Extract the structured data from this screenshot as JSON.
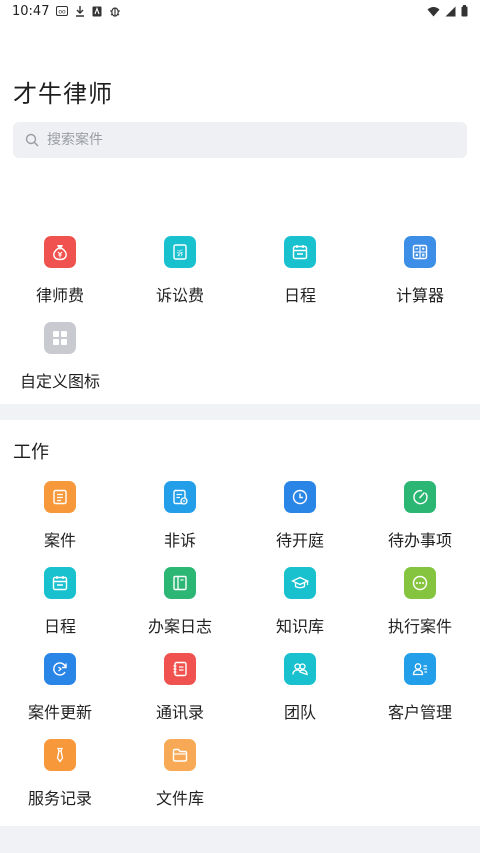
{
  "status_bar": {
    "time": "10:47",
    "left_icons": [
      "cast-icon",
      "download-icon",
      "font-icon",
      "bug-icon"
    ],
    "right_icons": [
      "wifi-icon",
      "signal-icon",
      "battery-icon"
    ]
  },
  "header": {
    "title": "才牛律师"
  },
  "search": {
    "placeholder": "搜索案件"
  },
  "quick_tools": [
    {
      "label": "律师费",
      "icon": "fee-bag-icon",
      "color": "#f0534f"
    },
    {
      "label": "诉讼费",
      "icon": "lawsuit-doc-icon",
      "color": "#19c1cf"
    },
    {
      "label": "日程",
      "icon": "calendar-icon",
      "color": "#19c1cf"
    },
    {
      "label": "计算器",
      "icon": "calculator-icon",
      "color": "#3d8ee6"
    },
    {
      "label": "自定义图标",
      "icon": "grid-icon",
      "color": "#c8cacf"
    }
  ],
  "work": {
    "title": "工作",
    "items": [
      {
        "label": "案件",
        "icon": "case-doc-icon",
        "color": "#f7983a"
      },
      {
        "label": "非诉",
        "icon": "non-lawsuit-icon",
        "color": "#239ee8"
      },
      {
        "label": "待开庭",
        "icon": "clock-icon",
        "color": "#2a86e6"
      },
      {
        "label": "待办事项",
        "icon": "todo-check-icon",
        "color": "#2bb673"
      },
      {
        "label": "日程",
        "icon": "calendar-icon",
        "color": "#19c1cf"
      },
      {
        "label": "办案日志",
        "icon": "log-book-icon",
        "color": "#2bb673"
      },
      {
        "label": "知识库",
        "icon": "graduation-cap-icon",
        "color": "#19c1cf"
      },
      {
        "label": "执行案件",
        "icon": "chat-dots-icon",
        "color": "#84c43f"
      },
      {
        "label": "案件更新",
        "icon": "update-refresh-icon",
        "color": "#2a86e6"
      },
      {
        "label": "通讯录",
        "icon": "contacts-book-icon",
        "color": "#f0534f"
      },
      {
        "label": "团队",
        "icon": "team-icon",
        "color": "#19c1cf"
      },
      {
        "label": "客户管理",
        "icon": "client-card-icon",
        "color": "#239ee8"
      },
      {
        "label": "服务记录",
        "icon": "tie-icon",
        "color": "#f7983a"
      },
      {
        "label": "文件库",
        "icon": "folder-icon",
        "color": "#f7a955"
      }
    ]
  }
}
